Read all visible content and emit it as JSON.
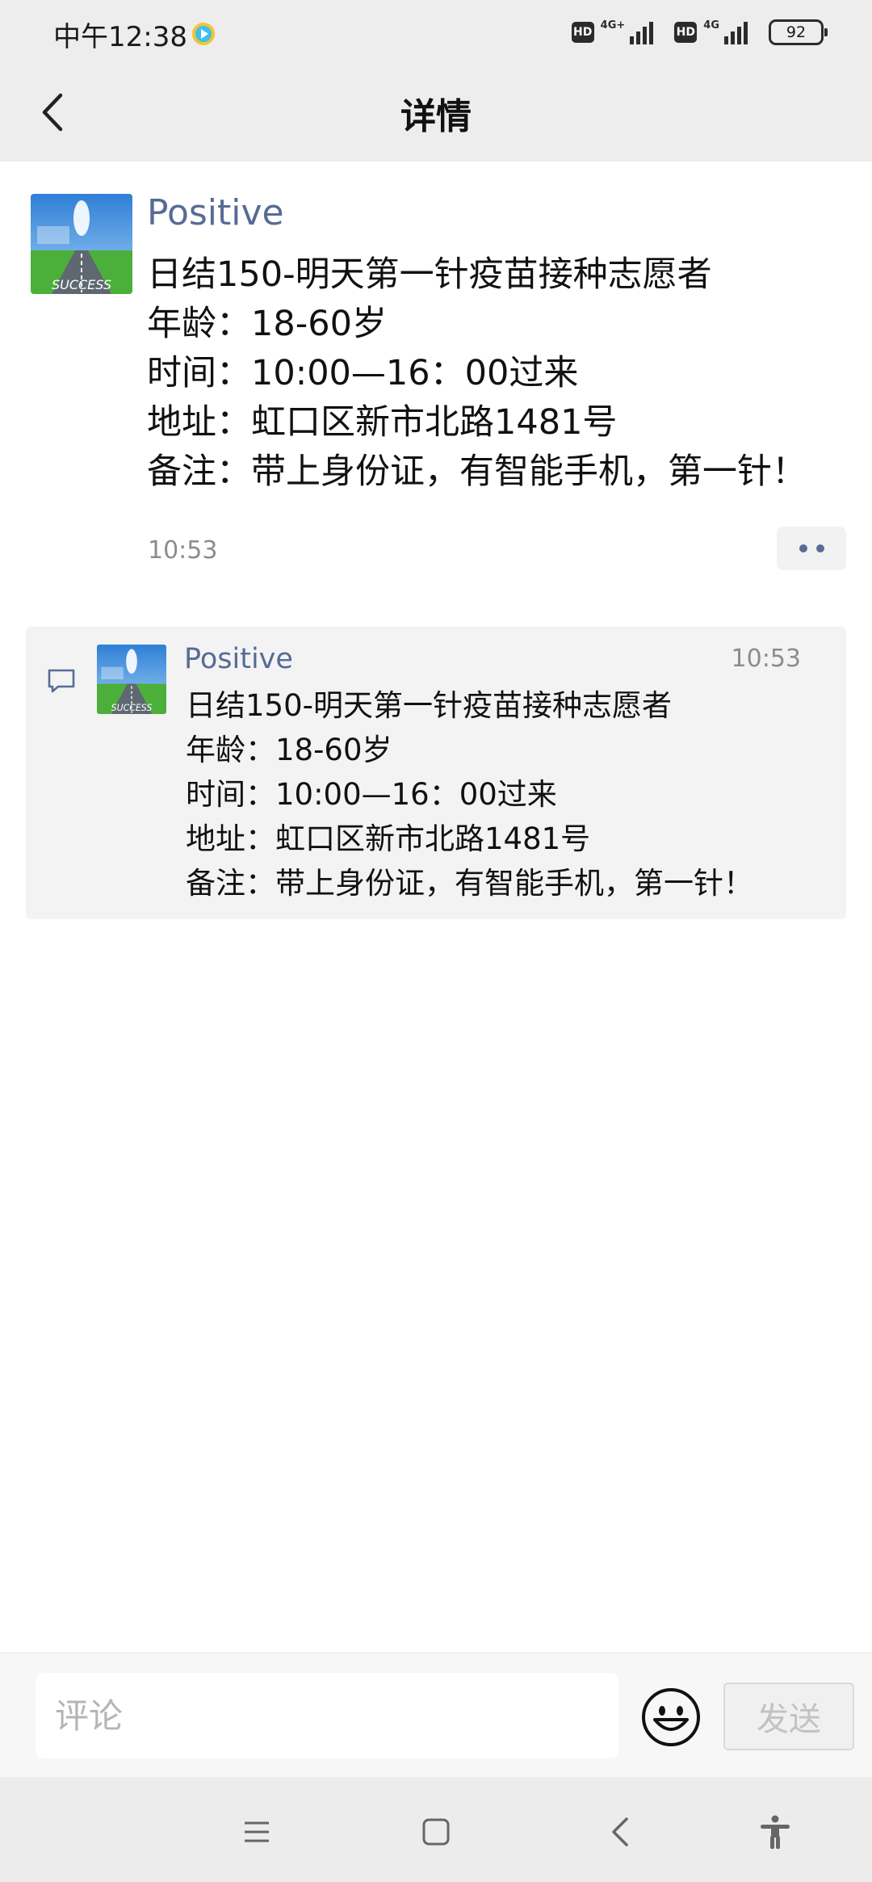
{
  "status_bar": {
    "time": "中午12:38",
    "hd_label": "HD",
    "network_1": "4G+",
    "network_2": "4G",
    "battery": "92"
  },
  "nav": {
    "title": "详情"
  },
  "post": {
    "author": "Positive",
    "lines": [
      "日结150-明天第一针疫苗接种志愿者",
      "年龄：18-60岁",
      "时间：10:00—16：00过来",
      "地址：虹口区新市北路1481号",
      "备注：带上身份证，有智能手机，第一针！"
    ],
    "time": "10:53"
  },
  "comment": {
    "author": "Positive",
    "time": "10:53",
    "lines": [
      "日结150-明天第一针疫苗接种志愿者",
      "年龄：18-60岁",
      "时间：10:00—16：00过来",
      "地址：虹口区新市北路1481号",
      "备注：带上身份证，有智能手机，第一针！"
    ]
  },
  "input_bar": {
    "placeholder": "评论",
    "send_label": "发送"
  },
  "icons": {
    "back": "chevron-left-icon",
    "more": "more-dots-icon",
    "comment": "comment-icon",
    "emoji": "smiley-icon",
    "menu": "menu-icon",
    "home": "home-square-icon",
    "system_back": "back-triangle-icon",
    "accessibility": "accessibility-icon"
  },
  "colors": {
    "link_blue": "#576b95",
    "header_bg": "#ededed",
    "comment_bg": "#f3f3f3"
  }
}
